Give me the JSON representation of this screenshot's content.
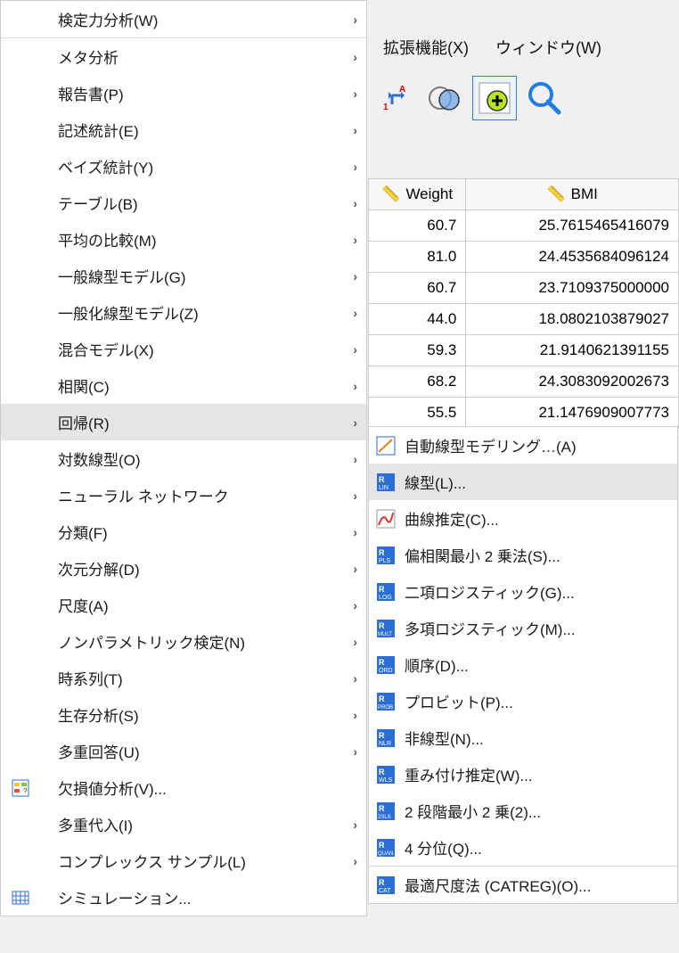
{
  "menu": {
    "power": "検定力分析(W)",
    "meta": "メタ分析",
    "report": "報告書(P)",
    "desc": "記述統計(E)",
    "bayes": "ベイズ統計(Y)",
    "table": "テーブル(B)",
    "meancmp": "平均の比較(M)",
    "glm": "一般線型モデル(G)",
    "gzlm": "一般化線型モデル(Z)",
    "mixed": "混合モデル(X)",
    "corr": "相関(C)",
    "regression": "回帰(R)",
    "loglin": "対数線型(O)",
    "neural": "ニューラル ネットワーク",
    "classify": "分類(F)",
    "dimred": "次元分解(D)",
    "scale": "尺度(A)",
    "nonpara": "ノンパラメトリック検定(N)",
    "timeseries": "時系列(T)",
    "survival": "生存分析(S)",
    "multresp": "多重回答(U)",
    "missing": "欠損値分析(V)...",
    "multimp": "多重代入(I)",
    "complex": "コンプレックス サンプル(L)",
    "sim": "シミュレーション..."
  },
  "sub": {
    "autolin": "自動線型モデリング…(A)",
    "lin": "線型(L)...",
    "curve": "曲線推定(C)...",
    "pls": "偏相関最小 2 乗法(S)...",
    "binlog": "二項ロジスティック(G)...",
    "multlog": "多項ロジスティック(M)...",
    "ordinal": "順序(D)...",
    "probit": "プロビット(P)...",
    "nonlin": "非線型(N)...",
    "wgt": "重み付け推定(W)...",
    "tsls": "2 段階最小 2 乗(2)...",
    "quant": "4 分位(Q)...",
    "catreg": "最適尺度法 (CATREG)(O)..."
  },
  "menubar": {
    "ext": "拡張機能(X)",
    "win": "ウィンドウ(W)"
  },
  "table": {
    "cols": {
      "weight": "Weight",
      "bmi": "BMI"
    },
    "rows": [
      {
        "w": "60.7",
        "b": "25.7615465416079"
      },
      {
        "w": "81.0",
        "b": "24.4535684096124"
      },
      {
        "w": "60.7",
        "b": "23.7109375000000"
      },
      {
        "w": "44.0",
        "b": "18.0802103879027"
      },
      {
        "w": "59.3",
        "b": "21.9140621391155"
      },
      {
        "w": "68.2",
        "b": "24.3083092002673"
      },
      {
        "w": "55.5",
        "b": "21.1476909007773"
      }
    ]
  }
}
